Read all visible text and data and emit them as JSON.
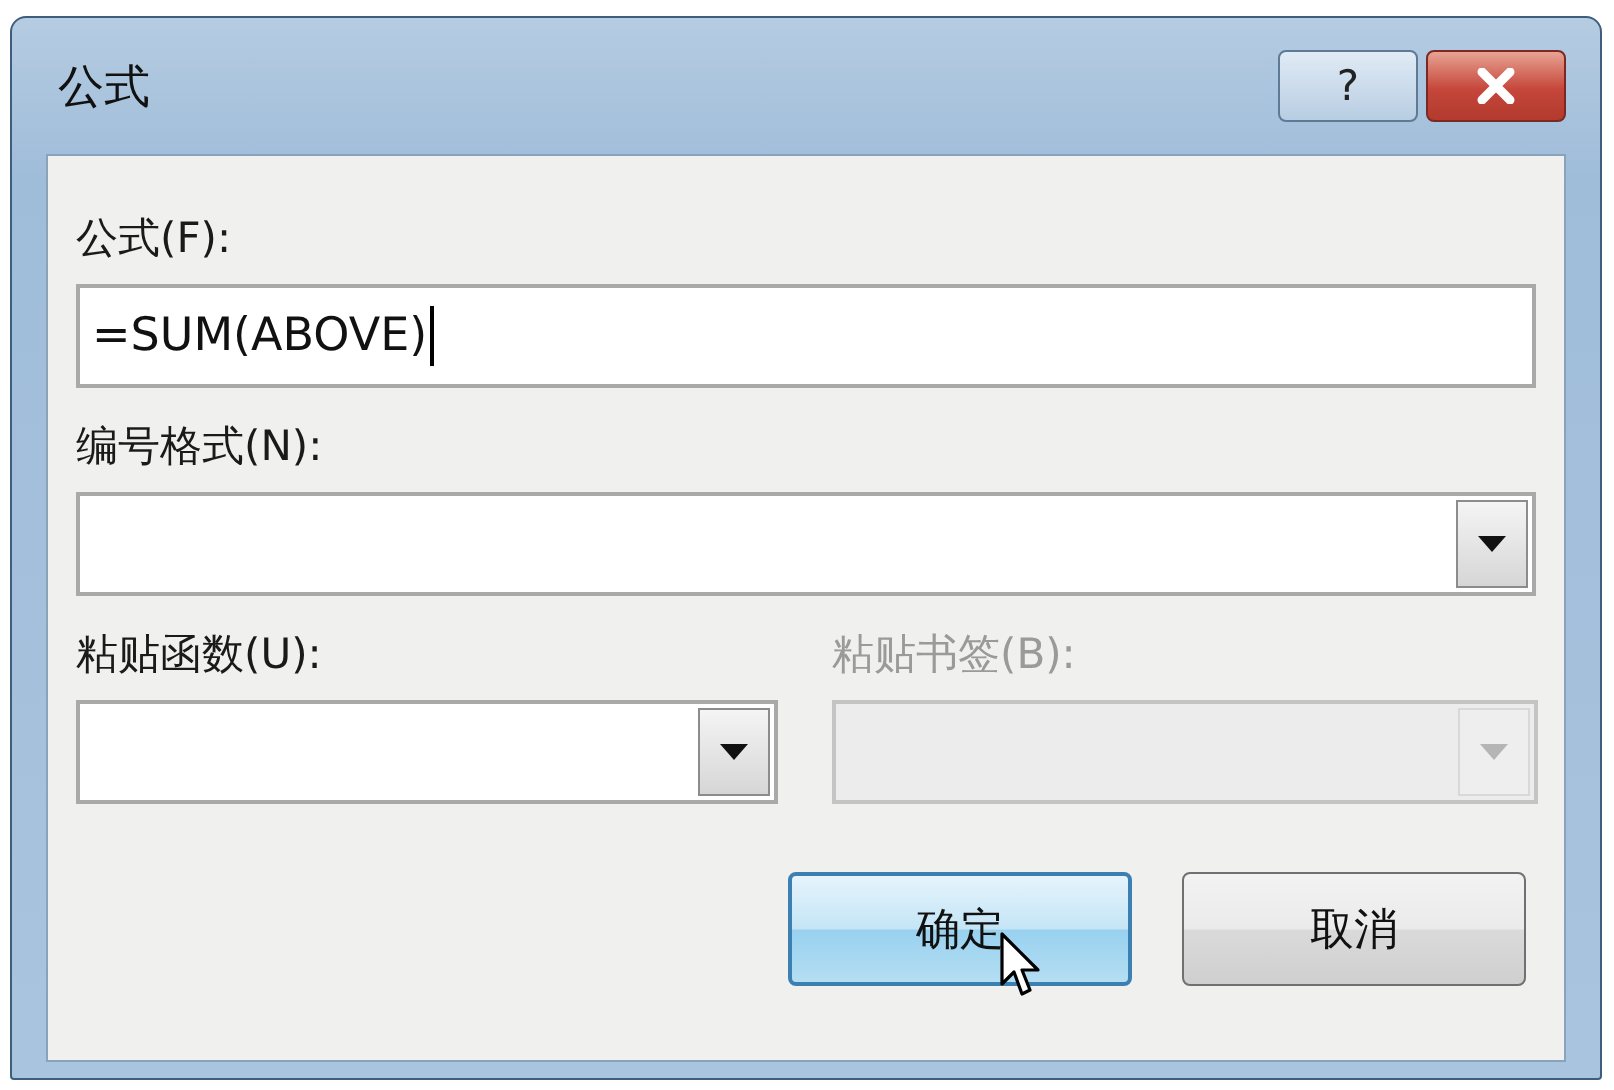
{
  "window": {
    "title": "公式",
    "help_button": "?"
  },
  "formula": {
    "label": "公式(F):",
    "value": "=SUM(ABOVE)",
    "focused": true
  },
  "dropdowns": [
    {
      "label": "编号格式(N):",
      "disabled": false
    },
    {
      "label": "粘贴函数(U):",
      "disabled": false
    },
    {
      "label": "粘贴书签(B):",
      "disabled": true
    }
  ],
  "buttons": [
    {
      "label": "确定",
      "default": true,
      "hovered": true
    },
    {
      "label": "取消",
      "default": false,
      "hovered": false
    }
  ]
}
